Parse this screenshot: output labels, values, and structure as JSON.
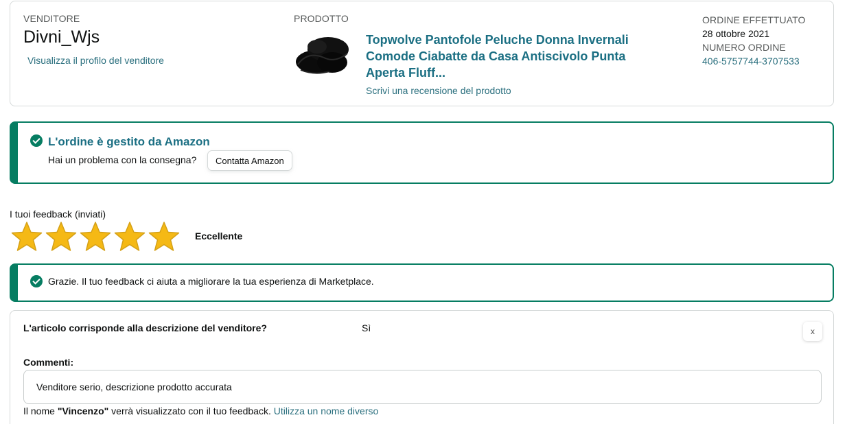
{
  "seller": {
    "header": "VENDITORE",
    "name": "Divni_Wjs",
    "profile_link": "Visualizza il profilo del venditore"
  },
  "product": {
    "header": "PRODOTTO",
    "title": "Topwolve Pantofole Peluche Donna Invernali Comode Ciabatte da Casa Antiscivolo Punta Aperta Fluff...",
    "review_link": "Scrivi una recensione del prodotto",
    "image_icon": "black-fluffy-slippers"
  },
  "order": {
    "placed_label": "ORDINE EFFETTUATO",
    "placed_date": "28 ottobre 2021",
    "number_label": "NUMERO ORDINE",
    "number": "406-5757744-3707533"
  },
  "fulfillment_alert": {
    "title": "L'ordine è gestito da Amazon",
    "question": "Hai un problema con la consegna?",
    "contact_button": "Contatta Amazon"
  },
  "feedback": {
    "title": "I tuoi feedback (inviati)",
    "rating": 5,
    "rating_max": 5,
    "rating_label": "Eccellente",
    "star_color": "#f5b915"
  },
  "thanks_alert": {
    "text": "Grazie. Il tuo feedback ci aiuta a migliorare la tua esperienza di Marketplace."
  },
  "details": {
    "question": "L'articolo corrisponde alla descrizione del venditore?",
    "answer": "Sì",
    "close_label": "x",
    "comments_label": "Commenti:",
    "comment_value": "Venditore serio, descrizione prodotto accurata",
    "name_prefix": "Il nome ",
    "name_value": "\"Vincenzo\"",
    "name_suffix": " verrà visualizzato con il tuo feedback. ",
    "name_change_link": "Utilizza un nome diverso"
  },
  "colors": {
    "accent_green": "#067d62",
    "link_teal": "#1b6f83"
  }
}
